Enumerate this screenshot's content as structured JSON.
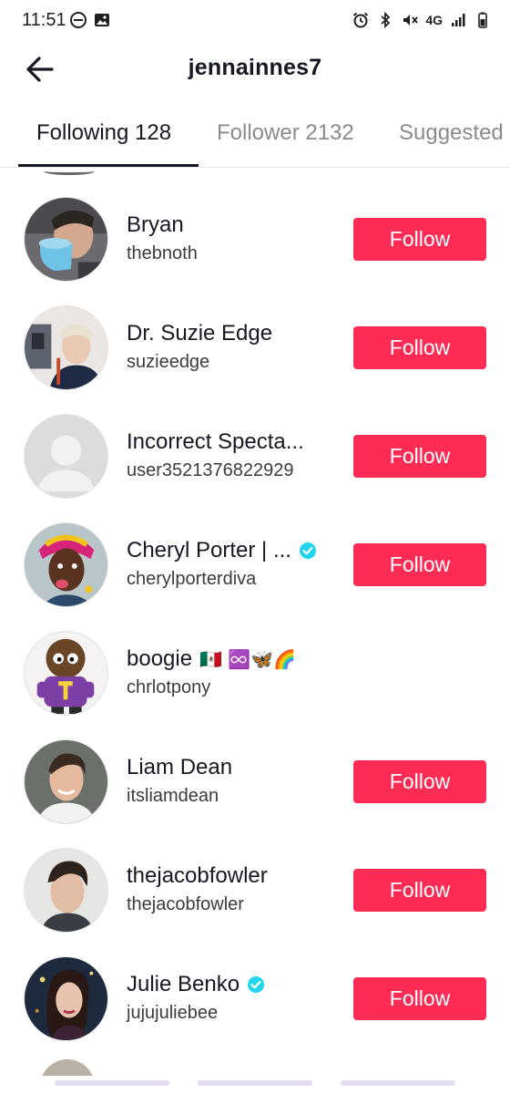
{
  "status_bar": {
    "time": "11:51",
    "left_icons": [
      "do-not-disturb-icon",
      "gallery-icon"
    ],
    "right_icons": [
      "alarm-icon",
      "bluetooth-icon",
      "mute-icon",
      "lte-icon",
      "signal-icon",
      "battery-icon"
    ],
    "network_label": "4G"
  },
  "header": {
    "title": "jennainnes7"
  },
  "tabs": [
    {
      "label": "Following 128",
      "active": true
    },
    {
      "label": "Follower 2132",
      "active": false
    },
    {
      "label": "Suggested",
      "active": false
    }
  ],
  "users": [
    {
      "name": "Bryan",
      "username": "thebnoth",
      "verified": false,
      "follow_label": "Follow",
      "avatar": "man-drinking-from-blue-mug"
    },
    {
      "name": "Dr. Suzie Edge",
      "username": "suzieedge",
      "verified": false,
      "follow_label": "Follow",
      "avatar": "person-with-blonde-hair"
    },
    {
      "name": "Incorrect Specta...",
      "username": "user3521376822929",
      "verified": false,
      "follow_label": "Follow",
      "avatar": "default-avatar"
    },
    {
      "name": "Cheryl Porter | ...",
      "username": "cherylporterdiva",
      "verified": true,
      "follow_label": "Follow",
      "avatar": "woman-with-colorful-headwrap"
    },
    {
      "name": "boogie",
      "name_emojis": "🇲🇽 ♾️🦋🌈",
      "username": "chrlotpony",
      "verified": false,
      "follow_label": "",
      "avatar": "purple-shirt-plush-toy"
    },
    {
      "name": "Liam Dean",
      "username": "itsliamdean",
      "verified": false,
      "follow_label": "Follow",
      "avatar": "smiling-man"
    },
    {
      "name": "thejacobfowler",
      "username": "thejacobfowler",
      "verified": false,
      "follow_label": "Follow",
      "avatar": "man-dark-hair"
    },
    {
      "name": "Julie Benko",
      "username": "jujujuliebee",
      "verified": true,
      "follow_label": "Follow",
      "avatar": "woman-singing"
    }
  ],
  "colors": {
    "follow_button": "#fe2c55",
    "verified_badge": "#20d5ec",
    "text_primary": "#161823",
    "text_secondary": "#8a8b91"
  }
}
